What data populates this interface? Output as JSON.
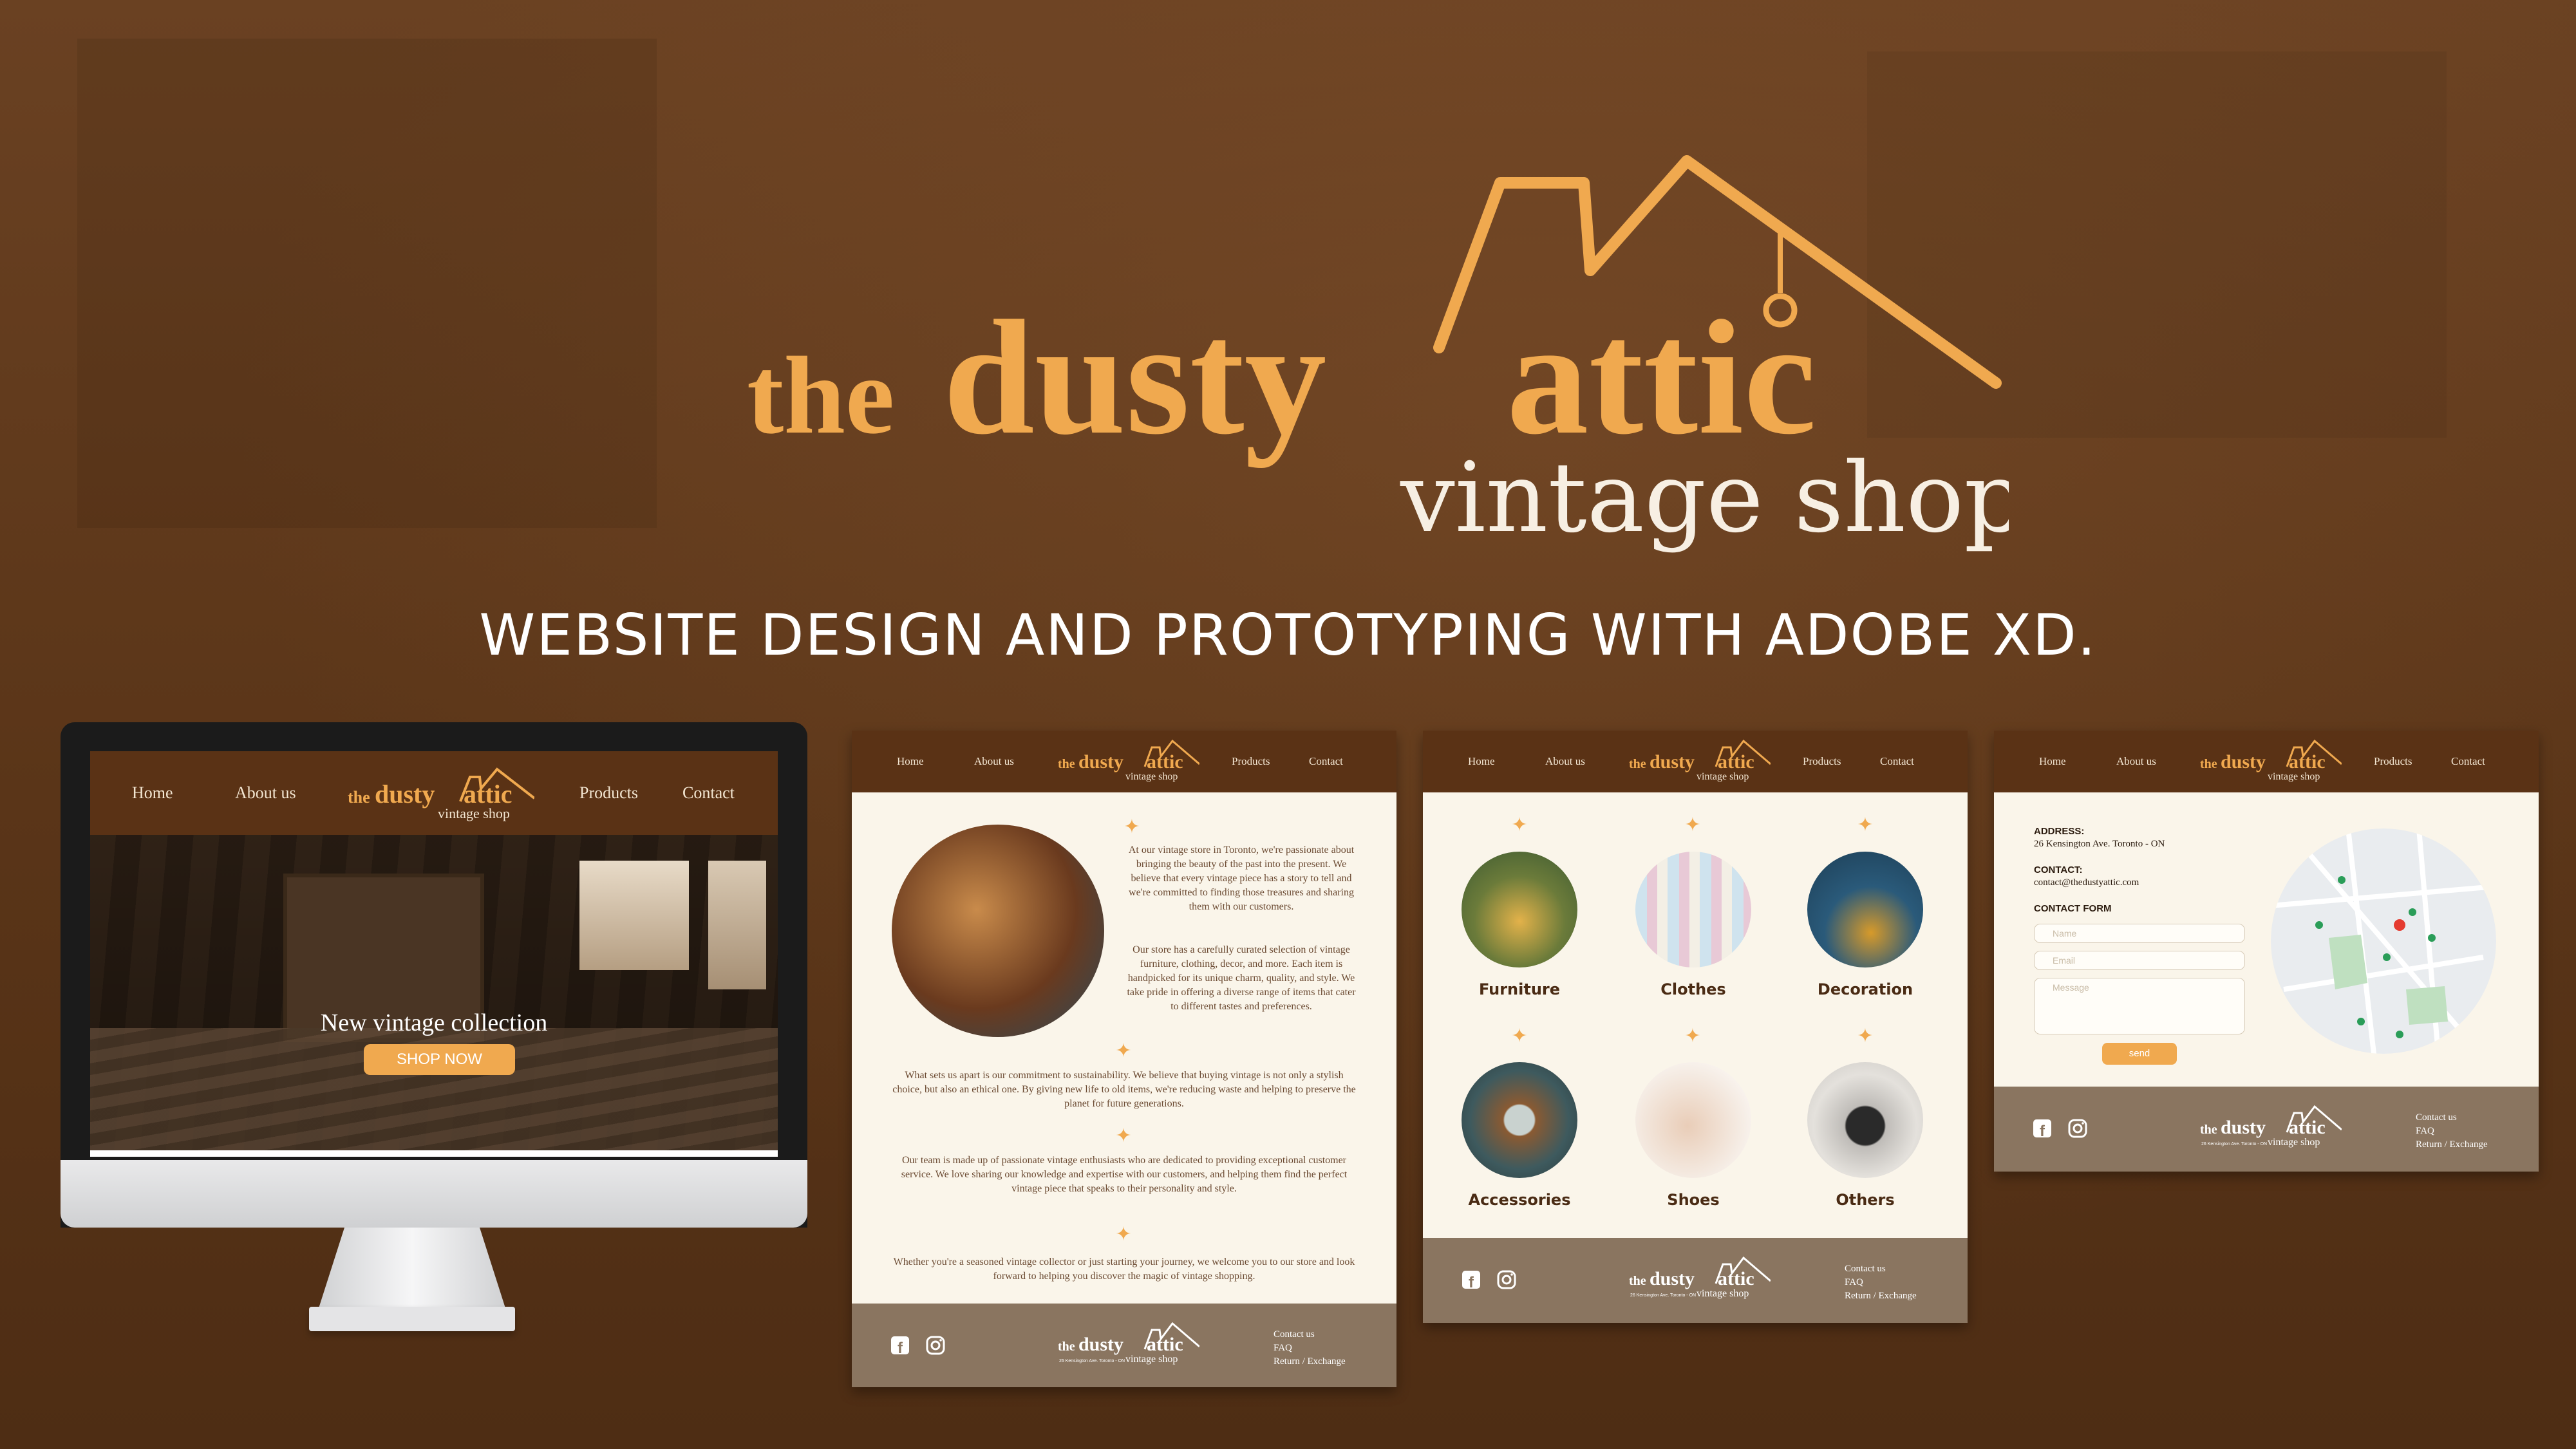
{
  "brand": {
    "the": "the",
    "dusty": "dusty",
    "attic": "attic",
    "tagline": "vintage shop"
  },
  "headline": "WEBSITE DESIGN AND PROTOTYPING WITH ADOBE XD.",
  "colors": {
    "background": "#5a3518",
    "accent": "#f0a94f",
    "nav": "#5a3215",
    "cream": "#faf5ea",
    "footer": "#8a7560"
  },
  "nav": {
    "home": "Home",
    "about": "About us",
    "products": "Products",
    "contact": "Contact"
  },
  "home_page": {
    "hero_title": "New vintage collection",
    "hero_button": "SHOP NOW"
  },
  "about_page": {
    "p1": "At our vintage store in Toronto, we're passionate about bringing the beauty of the past into the present. We believe that every vintage piece has a story to tell and we're committed to finding those treasures and sharing them with our customers.",
    "p2": "Our store has a carefully curated selection of vintage furniture, clothing, decor, and more. Each item is handpicked for its unique charm, quality, and style. We take pride in offering a diverse range of items that cater to different tastes and preferences.",
    "p3": "What sets us apart is our commitment to sustainability. We believe that buying vintage is not only a stylish choice, but also an ethical one. By giving new life to old items, we're reducing waste and helping to preserve the planet for future generations.",
    "p4": "Our team is made up of passionate vintage enthusiasts who are dedicated to providing exceptional customer service. We love sharing our knowledge and expertise with our customers, and helping them find the perfect vintage piece that speaks to their personality and style.",
    "p5": "Whether you're a seasoned vintage collector or just starting your journey, we welcome you to our store and look forward to helping you discover the magic of vintage shopping."
  },
  "products_page": {
    "categories": [
      "Furniture",
      "Clothes",
      "Decoration",
      "Accessories",
      "Shoes",
      "Others"
    ]
  },
  "contact_page": {
    "address_label": "ADDRESS:",
    "address_value": "26 Kensington Ave. Toronto - ON",
    "contact_label": "CONTACT:",
    "contact_value": "contact@thedustyattic.com",
    "form_label": "CONTACT FORM",
    "name_placeholder": "Name",
    "email_placeholder": "Email",
    "message_placeholder": "Message",
    "send_label": "send"
  },
  "footer": {
    "contact_us": "Contact us",
    "faq": "FAQ",
    "return": "Return / Exchange",
    "address_small": "26 Kensington Ave. Toronto - ON",
    "icons": [
      "facebook-icon",
      "instagram-icon"
    ]
  }
}
